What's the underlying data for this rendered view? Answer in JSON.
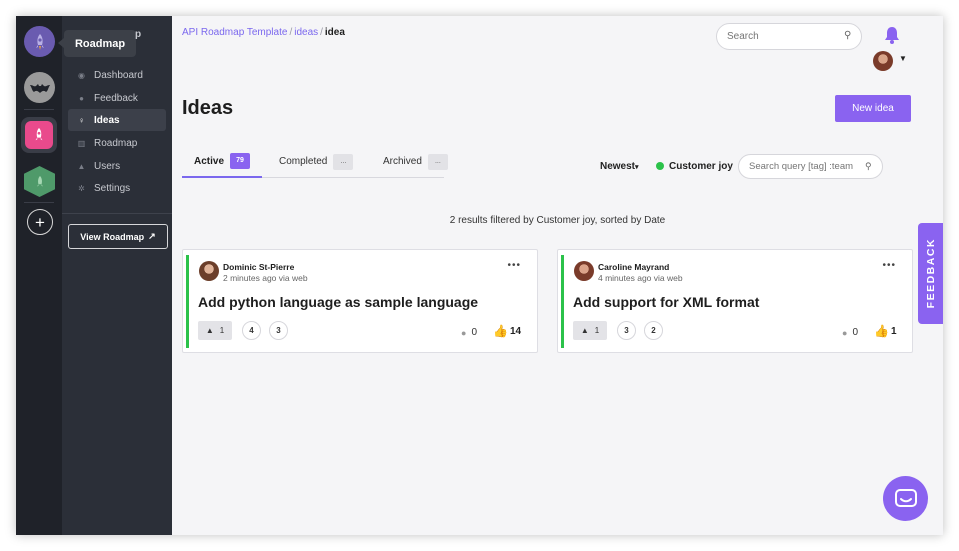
{
  "tooltip": {
    "label": "Roadmap",
    "tail": "p"
  },
  "sidebar": {
    "items": [
      {
        "label": "Dashboard",
        "icon": "dashboard-icon"
      },
      {
        "label": "Feedback",
        "icon": "chat-bubbles-icon"
      },
      {
        "label": "Ideas",
        "icon": "lightbulb-icon",
        "active": true
      },
      {
        "label": "Roadmap",
        "icon": "roadmap-icon"
      },
      {
        "label": "Users",
        "icon": "user-icon"
      },
      {
        "label": "Settings",
        "icon": "gear-icon"
      }
    ],
    "view_roadmap": "View Roadmap",
    "view_roadmap_icon": "↗"
  },
  "header": {
    "breadcrumb": [
      "API Roadmap Template",
      "ideas",
      "idea"
    ],
    "search_placeholder": "Search"
  },
  "page": {
    "title": "Ideas",
    "new_idea_label": "New idea"
  },
  "tabs": [
    {
      "label": "Active",
      "count": "79",
      "active": true
    },
    {
      "label": "Completed",
      "count": "...",
      "active": false
    },
    {
      "label": "Archived",
      "count": "...",
      "active": false
    }
  ],
  "filters": {
    "sort_label": "Newest",
    "filter_label": "Customer joy",
    "query_placeholder": "Search query [tag] :team"
  },
  "results_info": "2 results filtered by Customer joy, sorted by Date",
  "cards": [
    {
      "author": "Dominic St-Pierre",
      "time": "2 minutes ago via web",
      "title": "Add python language as sample language",
      "users": "1",
      "circle1": "4",
      "circle2": "3",
      "comments": "0",
      "votes": "14"
    },
    {
      "author": "Caroline Mayrand",
      "time": "4 minutes ago via web",
      "title": "Add support for XML format",
      "users": "1",
      "circle1": "3",
      "circle2": "2",
      "comments": "0",
      "votes": "1"
    }
  ],
  "feedback_tab": "FEEDBACK",
  "colors": {
    "accent": "#8a63f0",
    "status_green": "#2bc24a",
    "sidebar": "#2b2f38",
    "rail": "#1f2229"
  }
}
